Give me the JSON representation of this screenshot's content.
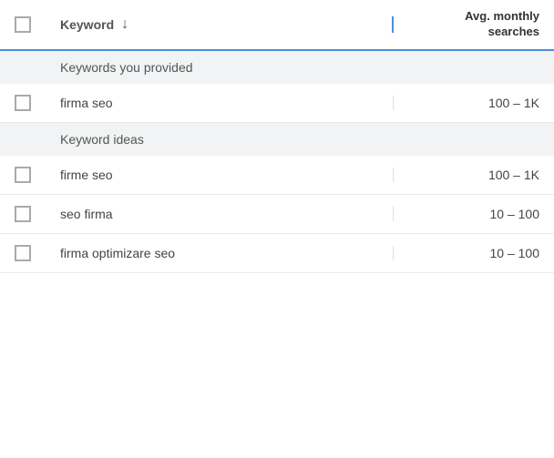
{
  "header": {
    "checkbox_col": "",
    "keyword_label": "Keyword",
    "sort_icon": "↓",
    "searches_label_line1": "Avg. monthly",
    "searches_label_line2": "searches"
  },
  "sections": [
    {
      "type": "section-header",
      "label": "Keywords you provided"
    },
    {
      "type": "row",
      "keyword": "firma seo",
      "searches": "100 – 1K"
    },
    {
      "type": "section-header",
      "label": "Keyword ideas"
    },
    {
      "type": "row",
      "keyword": "firme seo",
      "searches": "100 – 1K"
    },
    {
      "type": "row",
      "keyword": "seo firma",
      "searches": "10 – 100"
    },
    {
      "type": "row",
      "keyword": "firma optimizare seo",
      "searches": "10 – 100"
    }
  ]
}
